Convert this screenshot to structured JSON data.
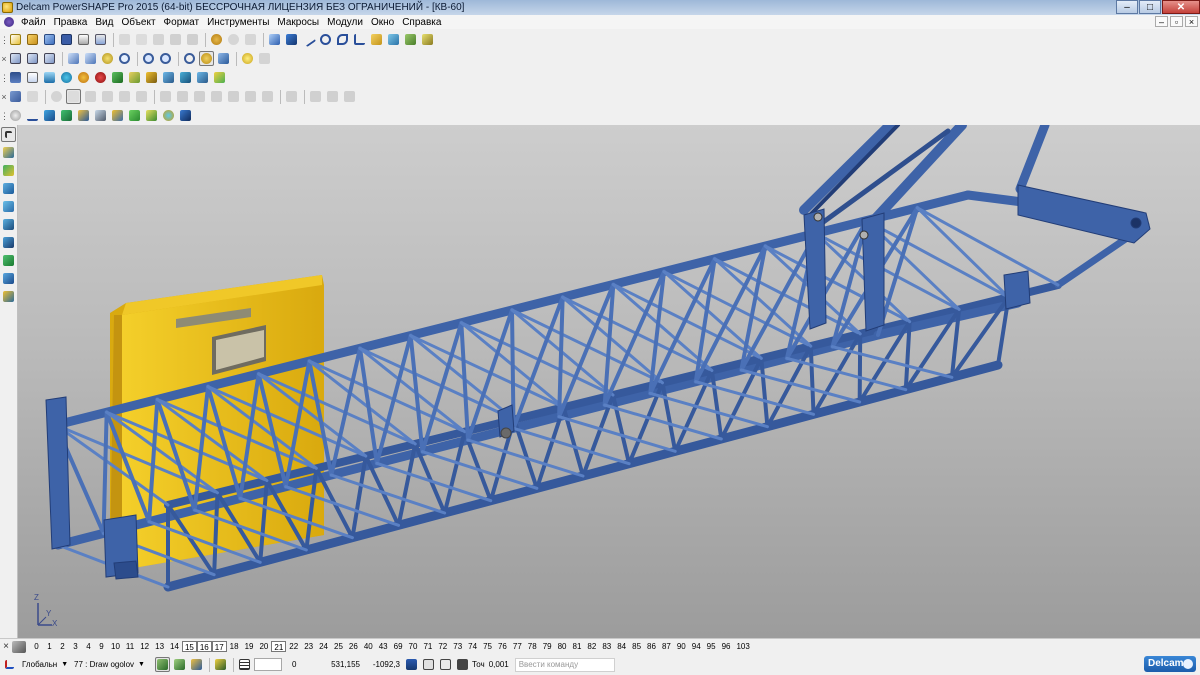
{
  "window": {
    "title": "Delcam PowerSHAPE Pro 2015 (64-bit) БЕССРОЧНАЯ ЛИЦЕНЗИЯ БЕЗ ОГРАНИЧЕНИЙ - [КВ-60]",
    "minimize": "–",
    "maximize": "□",
    "close": "✕"
  },
  "menu": {
    "items": [
      "Файл",
      "Правка",
      "Вид",
      "Объект",
      "Формат",
      "Инструменты",
      "Макросы",
      "Модули",
      "Окно",
      "Справка"
    ],
    "mdi_minimize": "–",
    "mdi_restore": "▫",
    "mdi_close": "×"
  },
  "colors": {
    "steel_blue": "#3e63a8",
    "steel_dark": "#223d77",
    "cab_yellow": "#e8c21a",
    "cab_shadow": "#bf9a08",
    "viewport_top": "#cdcdcd",
    "viewport_bottom": "#9c9c9c"
  },
  "viewport": {
    "axis_z": "Z",
    "axis_x": "X",
    "axis_y": "Y"
  },
  "levels": {
    "items": [
      "0",
      "1",
      "2",
      "3",
      "4",
      "9",
      "10",
      "11",
      "12",
      "13",
      "14",
      "15",
      "16",
      "17",
      "18",
      "19",
      "20",
      "21",
      "22",
      "23",
      "24",
      "25",
      "26",
      "40",
      "43",
      "69",
      "70",
      "71",
      "72",
      "73",
      "74",
      "75",
      "76",
      "77",
      "78",
      "79",
      "80",
      "81",
      "82",
      "83",
      "84",
      "85",
      "86",
      "87",
      "90",
      "94",
      "95",
      "96",
      "103"
    ],
    "active": [
      "15",
      "16",
      "17",
      "21"
    ]
  },
  "status": {
    "workplane": "Глобальн",
    "level_select": "77 : Draw ogolov",
    "field_zero": "0",
    "coord_x": "531,155",
    "coord_y": "-1092,3",
    "tol_label": "Точ",
    "tol_value": "0,001",
    "command_placeholder": "Ввести команду",
    "logo": "Delcam"
  }
}
